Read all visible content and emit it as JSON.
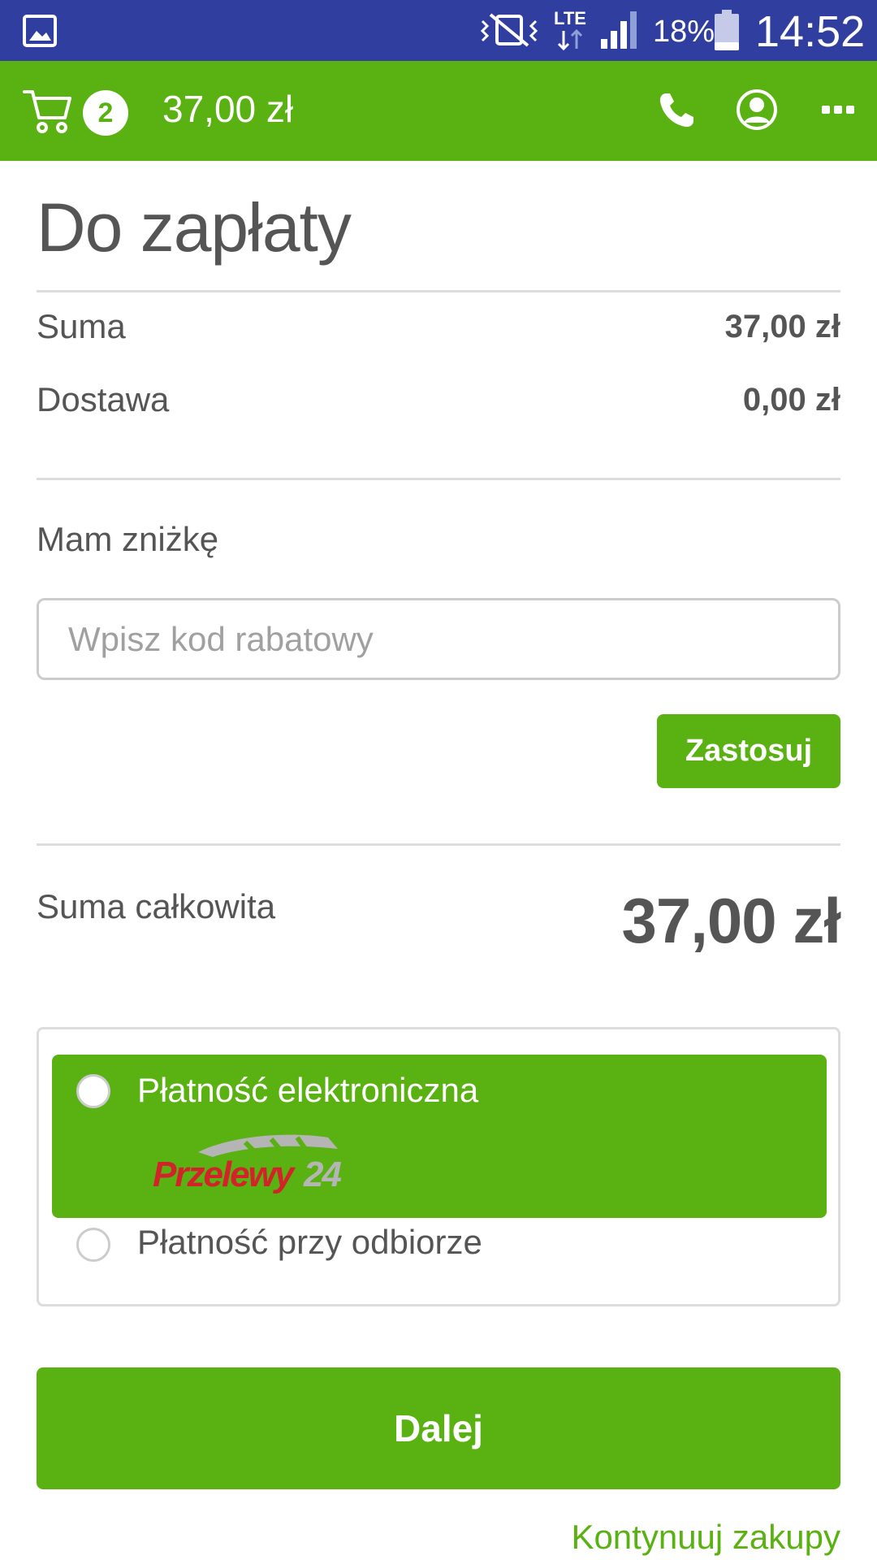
{
  "status_bar": {
    "battery": "18%",
    "time": "14:52",
    "network": "LTE",
    "icons": [
      "gallery-icon",
      "vibrate-mute-icon",
      "lte-icon",
      "signal-icon",
      "battery-icon"
    ]
  },
  "header": {
    "cart_count": "2",
    "cart_total": "37,00 zł",
    "icons": [
      "cart-icon",
      "phone-icon",
      "user-icon",
      "more-icon"
    ]
  },
  "page": {
    "title": "Do zapłaty"
  },
  "summary": {
    "subtotal_label": "Suma",
    "subtotal_value": "37,00 zł",
    "delivery_label": "Dostawa",
    "delivery_value": "0,00 zł"
  },
  "discount": {
    "label": "Mam zniżkę",
    "placeholder": "Wpisz kod rabatowy",
    "value": "",
    "apply_label": "Zastosuj"
  },
  "total": {
    "label": "Suma całkowita",
    "value": "37,00 zł"
  },
  "payment": {
    "options": [
      {
        "label": "Płatność elektroniczna",
        "selected": true,
        "logo": "Przelewy24"
      },
      {
        "label": "Płatność przy odbiorze",
        "selected": false
      }
    ]
  },
  "actions": {
    "next_label": "Dalej",
    "continue_label": "Kontynuuj zakupy"
  },
  "colors": {
    "accent": "#5ab112",
    "status_bar": "#303f9f",
    "text": "#555555"
  }
}
